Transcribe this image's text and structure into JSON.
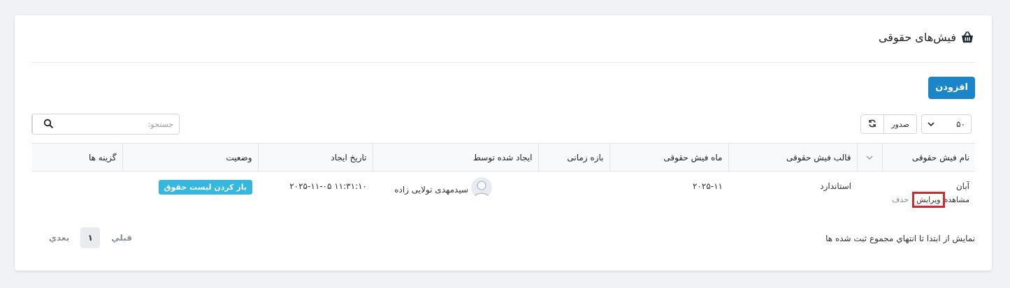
{
  "header": {
    "title": "فیش‌های حقوقی",
    "icon": "basket-icon"
  },
  "toolbar": {
    "add_label": "افزودن",
    "page_size": "۵۰",
    "export_label": "صدور",
    "search_placeholder": "جستجو:"
  },
  "table": {
    "columns": [
      "نام فیش حقوقی",
      "",
      "قالب فیش حقوقی",
      "ماه فیش حقوقی",
      "بازه زمانی",
      "ایجاد شده توسط",
      "تاریخ ایجاد",
      "وضعیت",
      "گزینه ها"
    ],
    "rows": [
      {
        "name": "آبان",
        "actions": {
          "view": "مشاهده",
          "edit": "ویرایش",
          "delete": "حذف"
        },
        "template": "استاندارد",
        "month": "۲۰۲۵-۱۱",
        "period": "",
        "creator": "سیدمهدی تولایی زاده",
        "created_at": "۲۰۲۵-۱۱-۰۵ ۱۱:۳۱:۱۰",
        "status": "باز کردن لیست حقوق",
        "options": ""
      }
    ]
  },
  "footer": {
    "info": "نمایش از ابتدا تا انتهاي مجموع ثبت شده ها",
    "prev": "قبلي",
    "page": "۱",
    "next": "بعدي"
  },
  "colors": {
    "primary": "#1a85c8",
    "status_badge": "#35b8e0",
    "highlight": "#d9252b"
  }
}
